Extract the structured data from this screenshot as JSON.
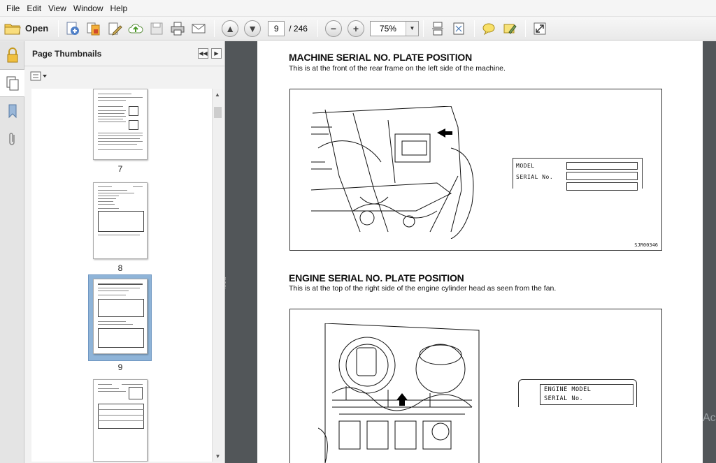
{
  "menu": [
    "File",
    "Edit",
    "View",
    "Window",
    "Help"
  ],
  "toolbar": {
    "open_label": "Open",
    "current_page": "9",
    "page_total": "/ 246",
    "zoom": "75%"
  },
  "sidebar": {
    "title": "Page Thumbnails",
    "thumbnails": [
      {
        "label": "7"
      },
      {
        "label": "8"
      },
      {
        "label": "9"
      }
    ]
  },
  "document": {
    "section1": {
      "title": "MACHINE SERIAL NO. PLATE POSITION",
      "text": "This is at the front of the rear frame on the left side of the machine.",
      "plate_model": "MODEL",
      "plate_serial": "SERIAL No.",
      "figure_code": "SJR00346"
    },
    "section2": {
      "title": "ENGINE SERIAL NO. PLATE POSITION",
      "text": "This is at the top of the right side of the engine cylinder head as seen from the fan.",
      "plate_model": "ENGINE MODEL",
      "plate_serial": "SERIAL No."
    }
  },
  "watermark_text": "Ac"
}
